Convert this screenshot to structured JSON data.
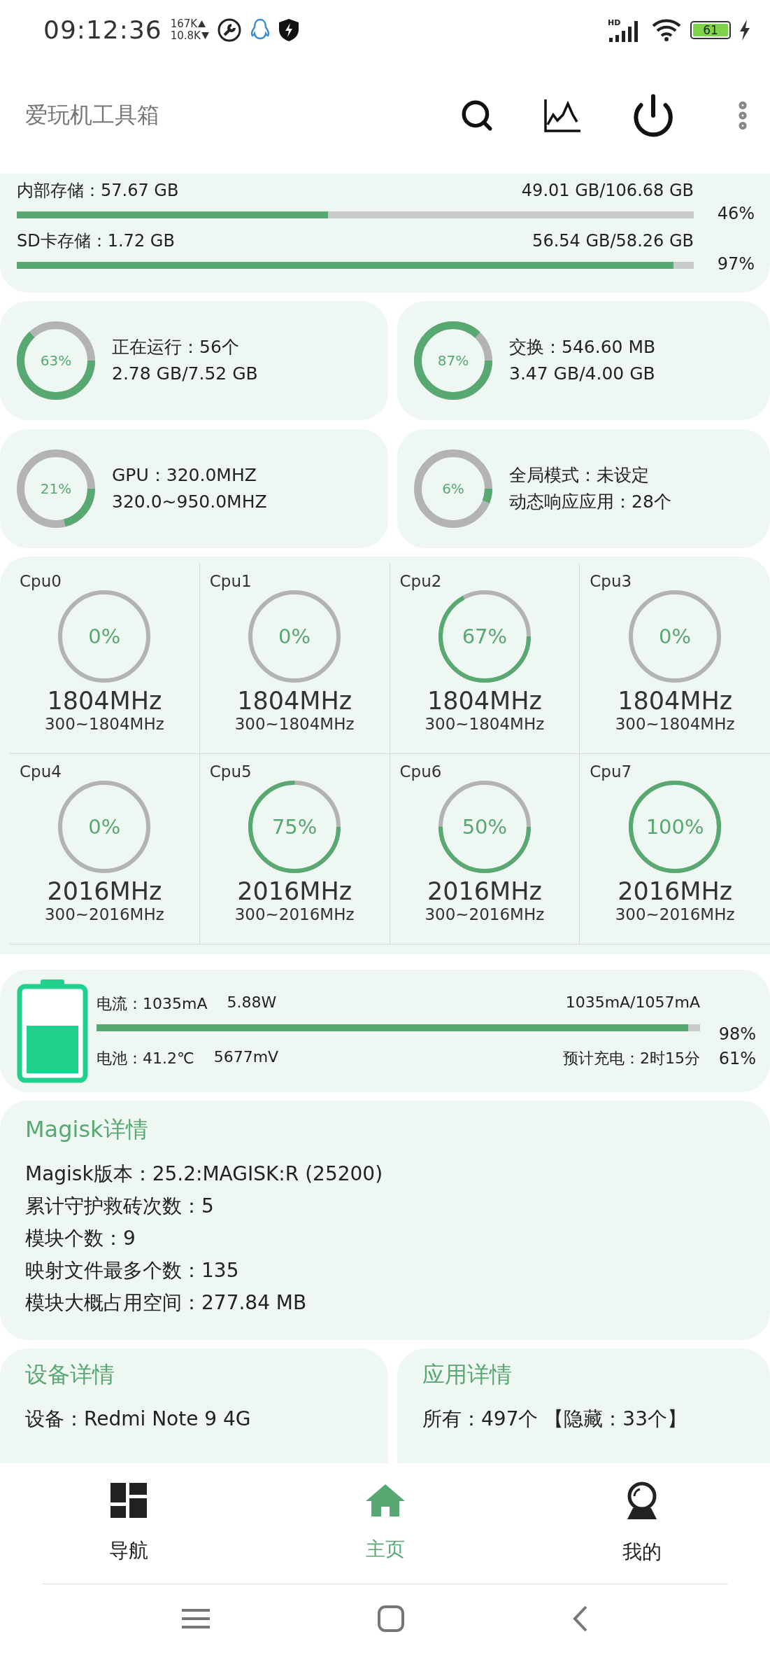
{
  "status_bar": {
    "time": "09:12:36",
    "upload": "167K",
    "download": "10.8K",
    "network": "HD",
    "battery": "61"
  },
  "toolbar": {
    "title": "爱玩机工具箱"
  },
  "storage": [
    {
      "label": "内部存储：57.67 GB",
      "usage": "49.01 GB/106.68 GB",
      "level": 0.46,
      "percent": "46%"
    },
    {
      "label": "SD卡存储：1.72 GB",
      "usage": "56.54 GB/58.26 GB",
      "level": 0.97,
      "percent": "97%"
    }
  ],
  "ring_cards": [
    {
      "percent": "63%",
      "level": 0.63,
      "lines": [
        "正在运行：56个",
        "2.78 GB/7.52 GB"
      ]
    },
    {
      "percent": "87%",
      "level": 0.87,
      "lines": [
        "交换：546.60 MB",
        "3.47 GB/4.00 GB"
      ]
    },
    {
      "percent": "21%",
      "level": 0.21,
      "lines": [
        "GPU：320.0MHZ",
        "320.0~950.0MHZ"
      ]
    },
    {
      "percent": "6%",
      "level": 0.06,
      "lines": [
        "全局模式：未设定",
        "动态响应应用：28个"
      ]
    }
  ],
  "cpus": [
    {
      "name": "Cpu0",
      "percent": "0%",
      "freq": "1804MHz",
      "range": "300~1804MHz"
    },
    {
      "name": "Cpu1",
      "percent": "0%",
      "freq": "1804MHz",
      "range": "300~1804MHz"
    },
    {
      "name": "Cpu2",
      "percent": "67%",
      "level": 0.67,
      "freq": "1804MHz",
      "range": "300~1804MHz"
    },
    {
      "name": "Cpu3",
      "percent": "0%",
      "freq": "1804MHz",
      "range": "300~1804MHz"
    },
    {
      "name": "Cpu4",
      "percent": "0%",
      "freq": "2016MHz",
      "range": "300~2016MHz"
    },
    {
      "name": "Cpu5",
      "percent": "75%",
      "level": 0.75,
      "freq": "2016MHz",
      "range": "300~2016MHz"
    },
    {
      "name": "Cpu6",
      "percent": "50%",
      "level": 0.5,
      "freq": "2016MHz",
      "range": "300~2016MHz"
    },
    {
      "name": "Cpu7",
      "percent": "100%",
      "level": 1,
      "freq": "2016MHz",
      "range": "300~2016MHz"
    }
  ],
  "battery": {
    "current": "电流：1035mA",
    "power": "5.88W",
    "current_ratio": "1035mA/1057mA",
    "level": 0.98,
    "percent": "98%",
    "temperature": "电池：41.2℃",
    "voltage": "5677mV",
    "charge_time": "预计充电：2时15分",
    "charge": "61%"
  },
  "magisk": {
    "title": "Magisk详情",
    "lines": [
      "Magisk版本：25.2:MAGISK:R (25200)",
      "累计守护救砖次数：5",
      "模块个数：9",
      "映射文件最多个数：135",
      "模块大概占用空间：277.84 MB"
    ]
  },
  "detail_cards": [
    {
      "title": "设备详情",
      "lines": [
        "设备：Redmi Note 9 4G"
      ]
    },
    {
      "title": "应用详情",
      "lines": [
        "所有：497个 【隐藏：33个】"
      ]
    }
  ],
  "nav": [
    {
      "kind": "dashboard",
      "label": "导航",
      "selected": false
    },
    {
      "kind": "home",
      "label": "主页",
      "selected": true
    },
    {
      "kind": "profile",
      "label": "我的",
      "selected": false
    }
  ]
}
